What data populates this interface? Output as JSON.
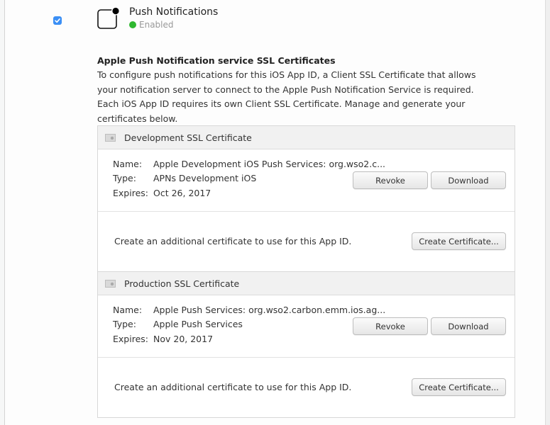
{
  "service": {
    "enabled_checkbox": true,
    "icon": "push-notification-icon",
    "title": "Push Notifications",
    "status": "Enabled",
    "status_color": "#2fb830"
  },
  "section": {
    "heading": "Apple Push Notification service SSL Certificates",
    "description": "To configure push notifications for this iOS App ID, a Client SSL Certificate that allows your notification server to connect to the Apple Push Notification Service is required. Each iOS App ID requires its own Client SSL Certificate. Manage and generate your certificates below."
  },
  "certificates": [
    {
      "title": "Development SSL Certificate",
      "icon": "certificate-icon",
      "name_label": "Name:",
      "name_value": "Apple Development iOS Push Services: org.wso2.c...",
      "type_label": "Type:",
      "type_value": "APNs Development iOS",
      "expires_label": "Expires:",
      "expires_value": "Oct 26, 2017",
      "revoke_label": "Revoke",
      "download_label": "Download",
      "create_text": "Create an additional certificate to use for this App ID.",
      "create_label": "Create Certificate..."
    },
    {
      "title": "Production SSL Certificate",
      "icon": "certificate-icon",
      "name_label": "Name:",
      "name_value": "Apple Push Services: org.wso2.carbon.emm.ios.ag...",
      "type_label": "Type:",
      "type_value": "Apple Push Services",
      "expires_label": "Expires:",
      "expires_value": "Nov 20, 2017",
      "revoke_label": "Revoke",
      "download_label": "Download",
      "create_text": "Create an additional certificate to use for this App ID.",
      "create_label": "Create Certificate..."
    }
  ]
}
